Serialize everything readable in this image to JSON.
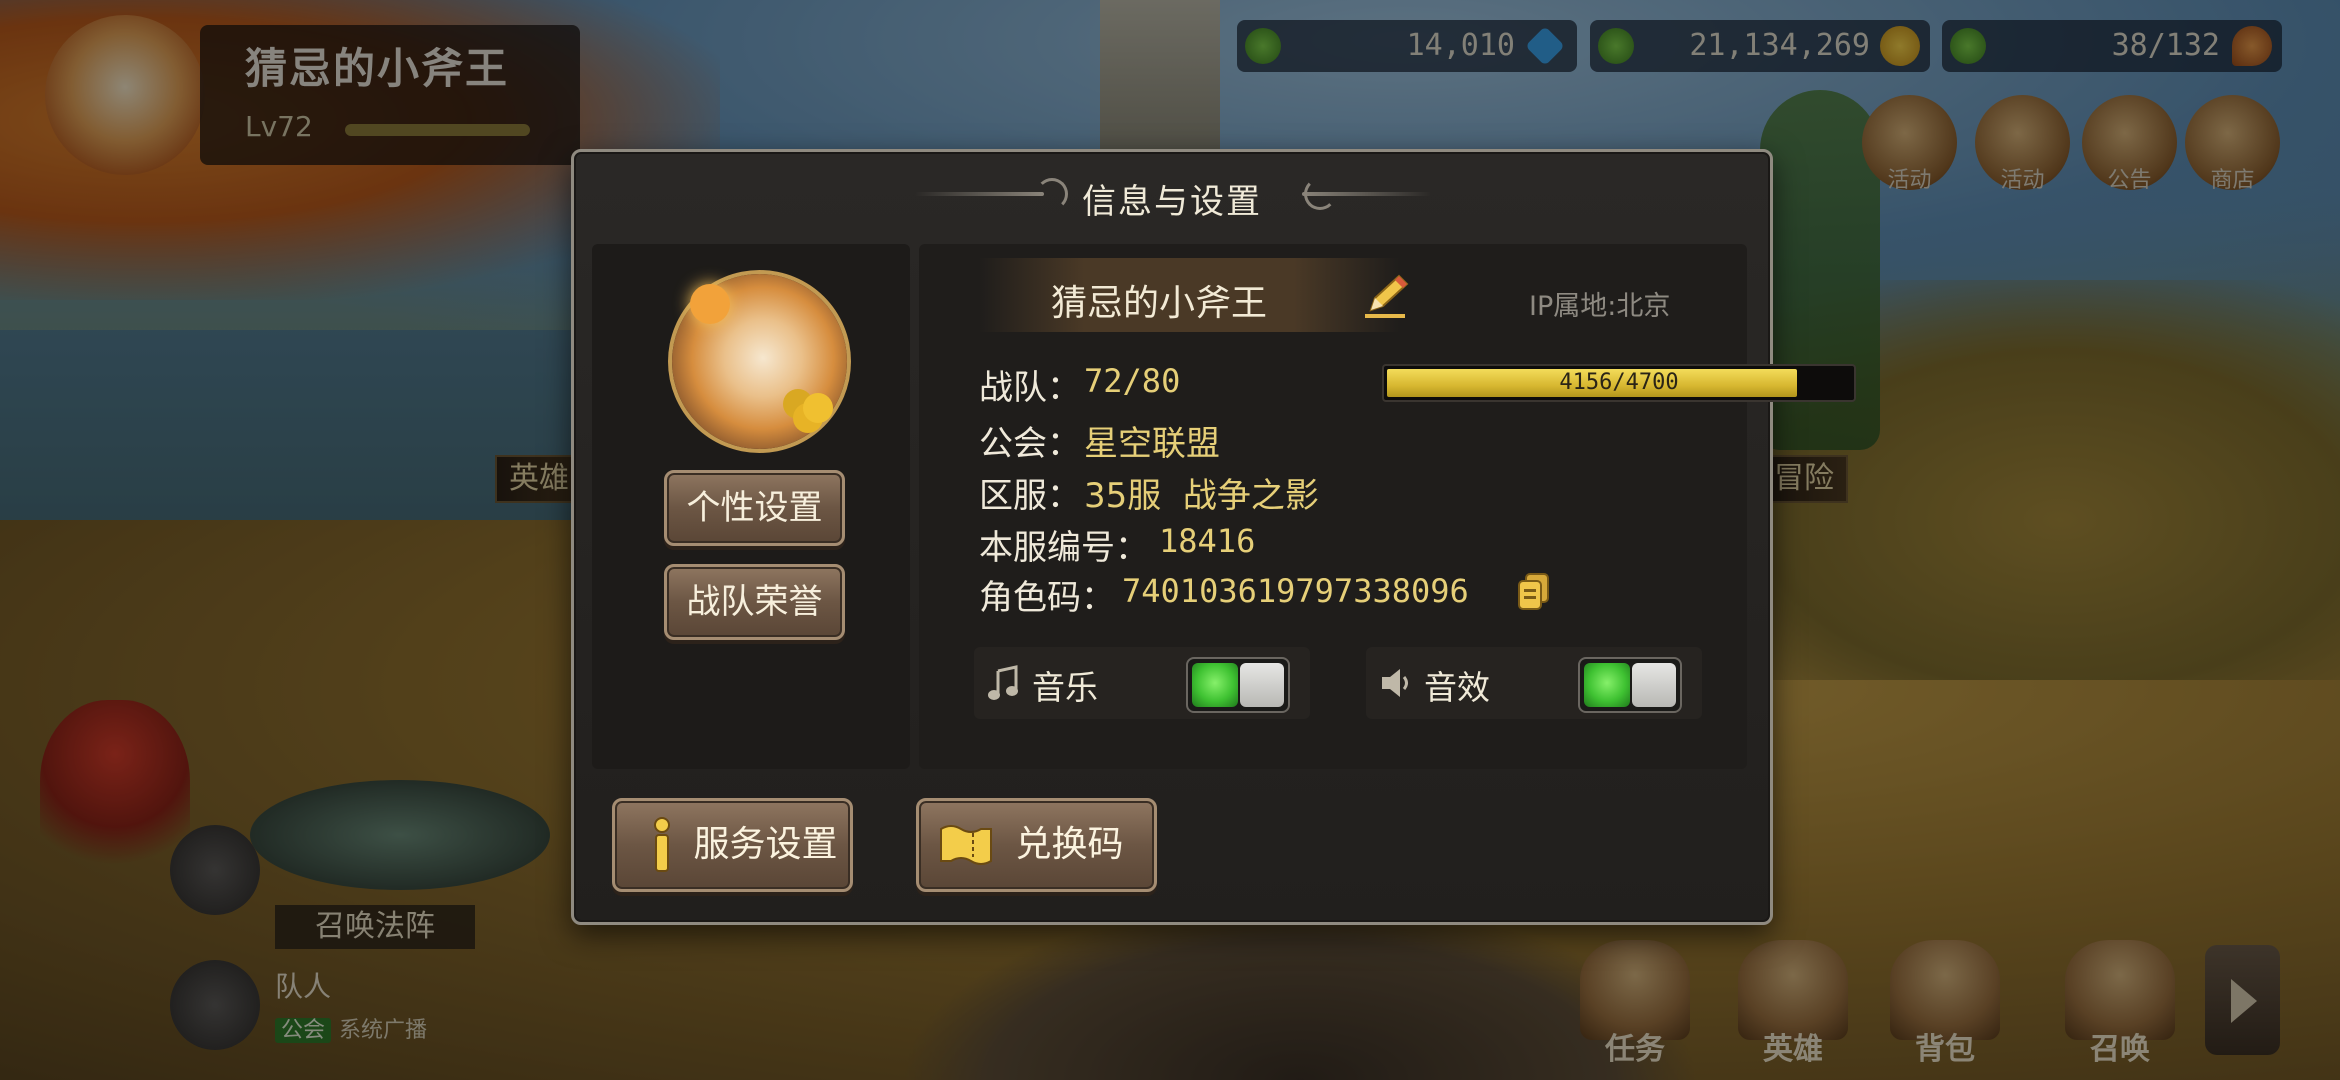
{
  "hud": {
    "player_name": "猜忌的小斧王",
    "level_label": "Lv72",
    "resources": [
      {
        "value": "14,010",
        "icon": "diamond-icon",
        "color": "#3aa0e8"
      },
      {
        "value": "21,134,269",
        "icon": "gold-coins-icon",
        "color": "#e8b52a"
      },
      {
        "value": "38/132",
        "icon": "drumstick-icon",
        "color": "#d2772e"
      }
    ],
    "right_menu": [
      "活动",
      "活动",
      "公告",
      "商店"
    ],
    "side_banner_left": "英雄",
    "side_banner_right": "冒险",
    "summon_label": "召唤法阵",
    "chat_name": "队人",
    "chat_tag": "公会",
    "chat_text": "系统广播",
    "bottom_nav": [
      "任务",
      "英雄",
      "背包",
      "召唤"
    ]
  },
  "dialog": {
    "title": "信息与设置",
    "buttons": {
      "personal_settings": "个性设置",
      "team_honor": "战队荣誉",
      "service_settings": "服务设置",
      "redeem_code": "兑换码"
    },
    "profile": {
      "name": "猜忌的小斧王",
      "ip_location": "IP属地:北京",
      "team_label": "战队：",
      "team_level": "72/80",
      "xp_text": "4156/4700",
      "xp_progress": 0.884,
      "guild_label": "公会：",
      "guild_value": "星空联盟",
      "server_label": "区服：",
      "server_value": "35服  战争之影",
      "server_id_label": "本服编号：",
      "server_id_value": "18416",
      "role_code_label": "角色码：",
      "role_code_value": "740103619797338096"
    },
    "toggles": {
      "music_label": "音乐",
      "music_on": true,
      "sfx_label": "音效",
      "sfx_on": true
    }
  },
  "colors": {
    "accent_gold": "#e6cf78",
    "toggle_green": "#3fc232",
    "button_brown": "#6c5644"
  }
}
